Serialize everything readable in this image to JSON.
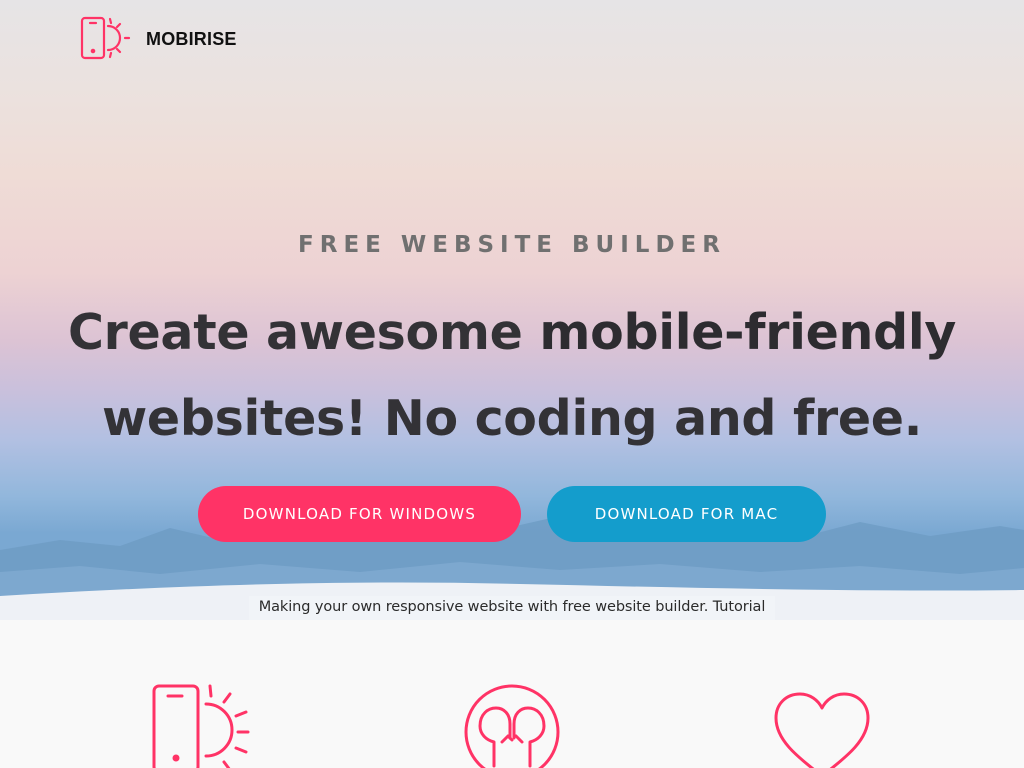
{
  "header": {
    "brand": "MOBIRISE",
    "logo_icon": "mobile-sun-icon"
  },
  "hero": {
    "kicker": "FREE WEBSITE BUILDER",
    "headline_regular": "Create awesome ",
    "headline_bold": "mobile-friendly",
    "headline_rest": "websites! No coding and free.",
    "caption": "Making your own responsive website with free website builder. Tutorial"
  },
  "buttons": {
    "windows_label": "DOWNLOAD FOR WINDOWS",
    "mac_label": "DOWNLOAD FOR MAC"
  },
  "features": {
    "icons": [
      "mobile-sun-icon",
      "touch-gesture-icon",
      "heart-icon"
    ]
  },
  "colors": {
    "accent": "#ff3366",
    "secondary": "#149dcc",
    "icon_stroke": "#ff3366"
  }
}
